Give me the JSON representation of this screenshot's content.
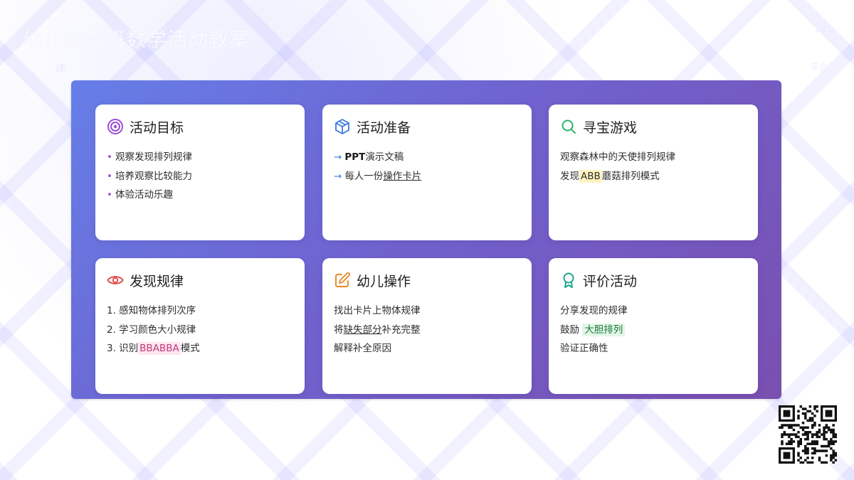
{
  "header": {
    "title": "幼儿园中班数学活动教案",
    "subtitle": "洋",
    "right_top": "201",
    "right_bottom": "平台"
  },
  "colors": {
    "panel_start": "#667ee8",
    "panel_end": "#7a4fb0",
    "target": "#9a4fd6",
    "box": "#3a7ad9",
    "search": "#2cb56b",
    "eye": "#e04848",
    "edit": "#e88a2a",
    "award": "#18a58a"
  },
  "cards": [
    {
      "title": "活动目标",
      "icon": "target-icon",
      "lines": [
        {
          "marker": "•",
          "text": "观察发现排列规律"
        },
        {
          "marker": "•",
          "text": "培养观察比较能力"
        },
        {
          "marker": "•",
          "text": "体验活动乐趣"
        }
      ]
    },
    {
      "title": "活动准备",
      "icon": "box-icon",
      "lines": [
        {
          "marker": "→",
          "strong": "PPT",
          "text": "演示文稿"
        },
        {
          "marker": "→",
          "pre": "每人一份",
          "u": "操作卡片"
        }
      ]
    },
    {
      "title": "寻宝游戏",
      "icon": "search-icon",
      "lines": [
        {
          "text": "观察森林中的天使排列规律"
        },
        {
          "pre": "发现",
          "hl": "ABB",
          "post": "蘑菇排列模式"
        }
      ]
    },
    {
      "title": "发现规律",
      "icon": "eye-icon",
      "lines": [
        {
          "text": "1. 感知物体排列次序"
        },
        {
          "text": "2. 学习颜色大小规律"
        },
        {
          "pre": "3. 识别",
          "hl": "BBABBA",
          "post": "模式"
        }
      ]
    },
    {
      "title": "幼儿操作",
      "icon": "edit-icon",
      "lines": [
        {
          "text": "找出卡片上物体规律"
        },
        {
          "pre": "将",
          "u": "缺失部分",
          "post": "补充完整"
        },
        {
          "text": "解释补全原因"
        }
      ]
    },
    {
      "title": "评价活动",
      "icon": "award-icon",
      "lines": [
        {
          "text": "分享发现的规律"
        },
        {
          "pre": "鼓励",
          "hl": "大胆排列"
        },
        {
          "text": "验证正确性"
        }
      ]
    }
  ]
}
